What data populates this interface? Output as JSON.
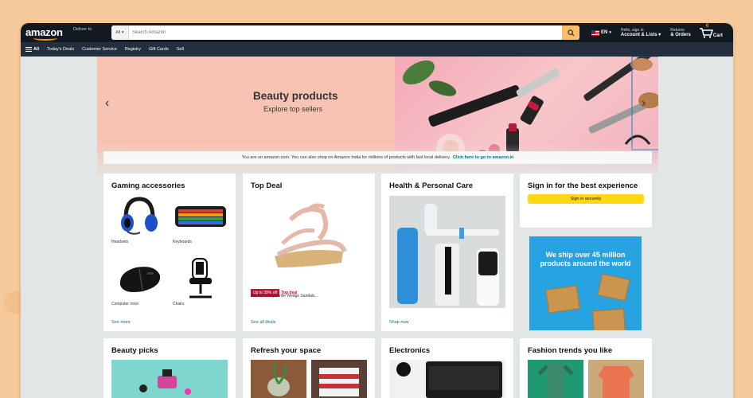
{
  "header": {
    "logo": "amazon",
    "deliver_to": "Deliver to",
    "search_category": "All",
    "search_placeholder": "Search Amazon",
    "language": "EN",
    "account_small": "Hello, sign in",
    "account_big": "Account & Lists",
    "returns_small": "Returns",
    "returns_big": "& Orders",
    "cart_count": "0",
    "cart_label": "Cart"
  },
  "nav": {
    "all": "All",
    "items": [
      "Today's Deals",
      "Customer Service",
      "Registry",
      "Gift Cards",
      "Sell"
    ]
  },
  "hero": {
    "title": "Beauty products",
    "subtitle": "Explore top sellers"
  },
  "india_bar": {
    "text": "You are on amazon.com. You can also shop on Amazon India for millions of products with fast local delivery.",
    "link": "Click here to go to amazon.in"
  },
  "cards": {
    "gaming": {
      "title": "Gaming accessories",
      "items": [
        "Headsets",
        "Keyboards",
        "Computer mice",
        "Chairs"
      ],
      "link": "See more"
    },
    "topdeal": {
      "title": "Top Deal",
      "badge": "Up to 39% off",
      "badge2": "Top deal",
      "desc": "Women's Espadrille Wedge Sandals...",
      "link": "See all deals"
    },
    "health": {
      "title": "Health & Personal Care",
      "link": "Shop now"
    },
    "signin": {
      "title": "Sign in for the best experience",
      "button": "Sign in securely"
    },
    "ship_ad": {
      "text": "We ship over 45 million products around the world"
    },
    "beauty": {
      "title": "Beauty picks"
    },
    "refresh": {
      "title": "Refresh your space"
    },
    "electronics": {
      "title": "Electronics"
    },
    "fashion": {
      "title": "Fashion trends you like"
    }
  },
  "colors": {
    "header_bg": "#131921",
    "nav_bg": "#232f3e",
    "search_button": "#febd69",
    "signin_button": "#ffd814",
    "link": "#007185"
  }
}
